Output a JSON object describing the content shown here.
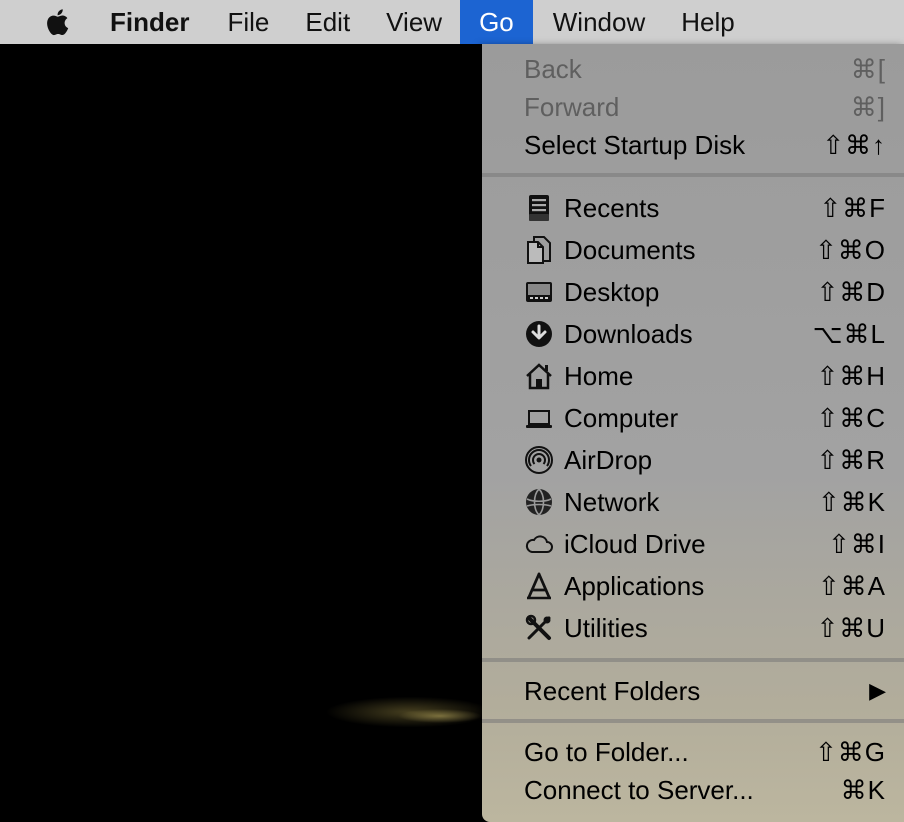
{
  "menubar": {
    "apple_icon": "apple-logo-icon",
    "items": [
      {
        "label": "Finder"
      },
      {
        "label": "File"
      },
      {
        "label": "Edit"
      },
      {
        "label": "View"
      },
      {
        "label": "Go"
      },
      {
        "label": "Window"
      },
      {
        "label": "Help"
      }
    ],
    "active_item": "Go",
    "highlight_color": "#1c64d2"
  },
  "go_menu": {
    "nav": [
      {
        "label": "Back",
        "shortcut": "⌘[",
        "enabled": false
      },
      {
        "label": "Forward",
        "shortcut": "⌘]",
        "enabled": false
      },
      {
        "label": "Select Startup Disk",
        "shortcut": "⇧⌘↑",
        "enabled": true
      }
    ],
    "places": [
      {
        "label": "Recents",
        "shortcut": "⇧⌘F",
        "icon": "recents-icon"
      },
      {
        "label": "Documents",
        "shortcut": "⇧⌘O",
        "icon": "documents-icon"
      },
      {
        "label": "Desktop",
        "shortcut": "⇧⌘D",
        "icon": "desktop-icon"
      },
      {
        "label": "Downloads",
        "shortcut": "⌥⌘L",
        "icon": "downloads-icon"
      },
      {
        "label": "Home",
        "shortcut": "⇧⌘H",
        "icon": "home-icon"
      },
      {
        "label": "Computer",
        "shortcut": "⇧⌘C",
        "icon": "computer-icon"
      },
      {
        "label": "AirDrop",
        "shortcut": "⇧⌘R",
        "icon": "airdrop-icon"
      },
      {
        "label": "Network",
        "shortcut": "⇧⌘K",
        "icon": "network-icon"
      },
      {
        "label": "iCloud Drive",
        "shortcut": "⇧⌘I",
        "icon": "icloud-icon"
      },
      {
        "label": "Applications",
        "shortcut": "⇧⌘A",
        "icon": "applications-icon"
      },
      {
        "label": "Utilities",
        "shortcut": "⇧⌘U",
        "icon": "utilities-icon"
      }
    ],
    "recent_folders": {
      "label": "Recent Folders",
      "submenu_arrow": "▶"
    },
    "actions": [
      {
        "label": "Go to Folder...",
        "shortcut": "⇧⌘G"
      },
      {
        "label": "Connect to Server...",
        "shortcut": "⌘K"
      }
    ]
  }
}
